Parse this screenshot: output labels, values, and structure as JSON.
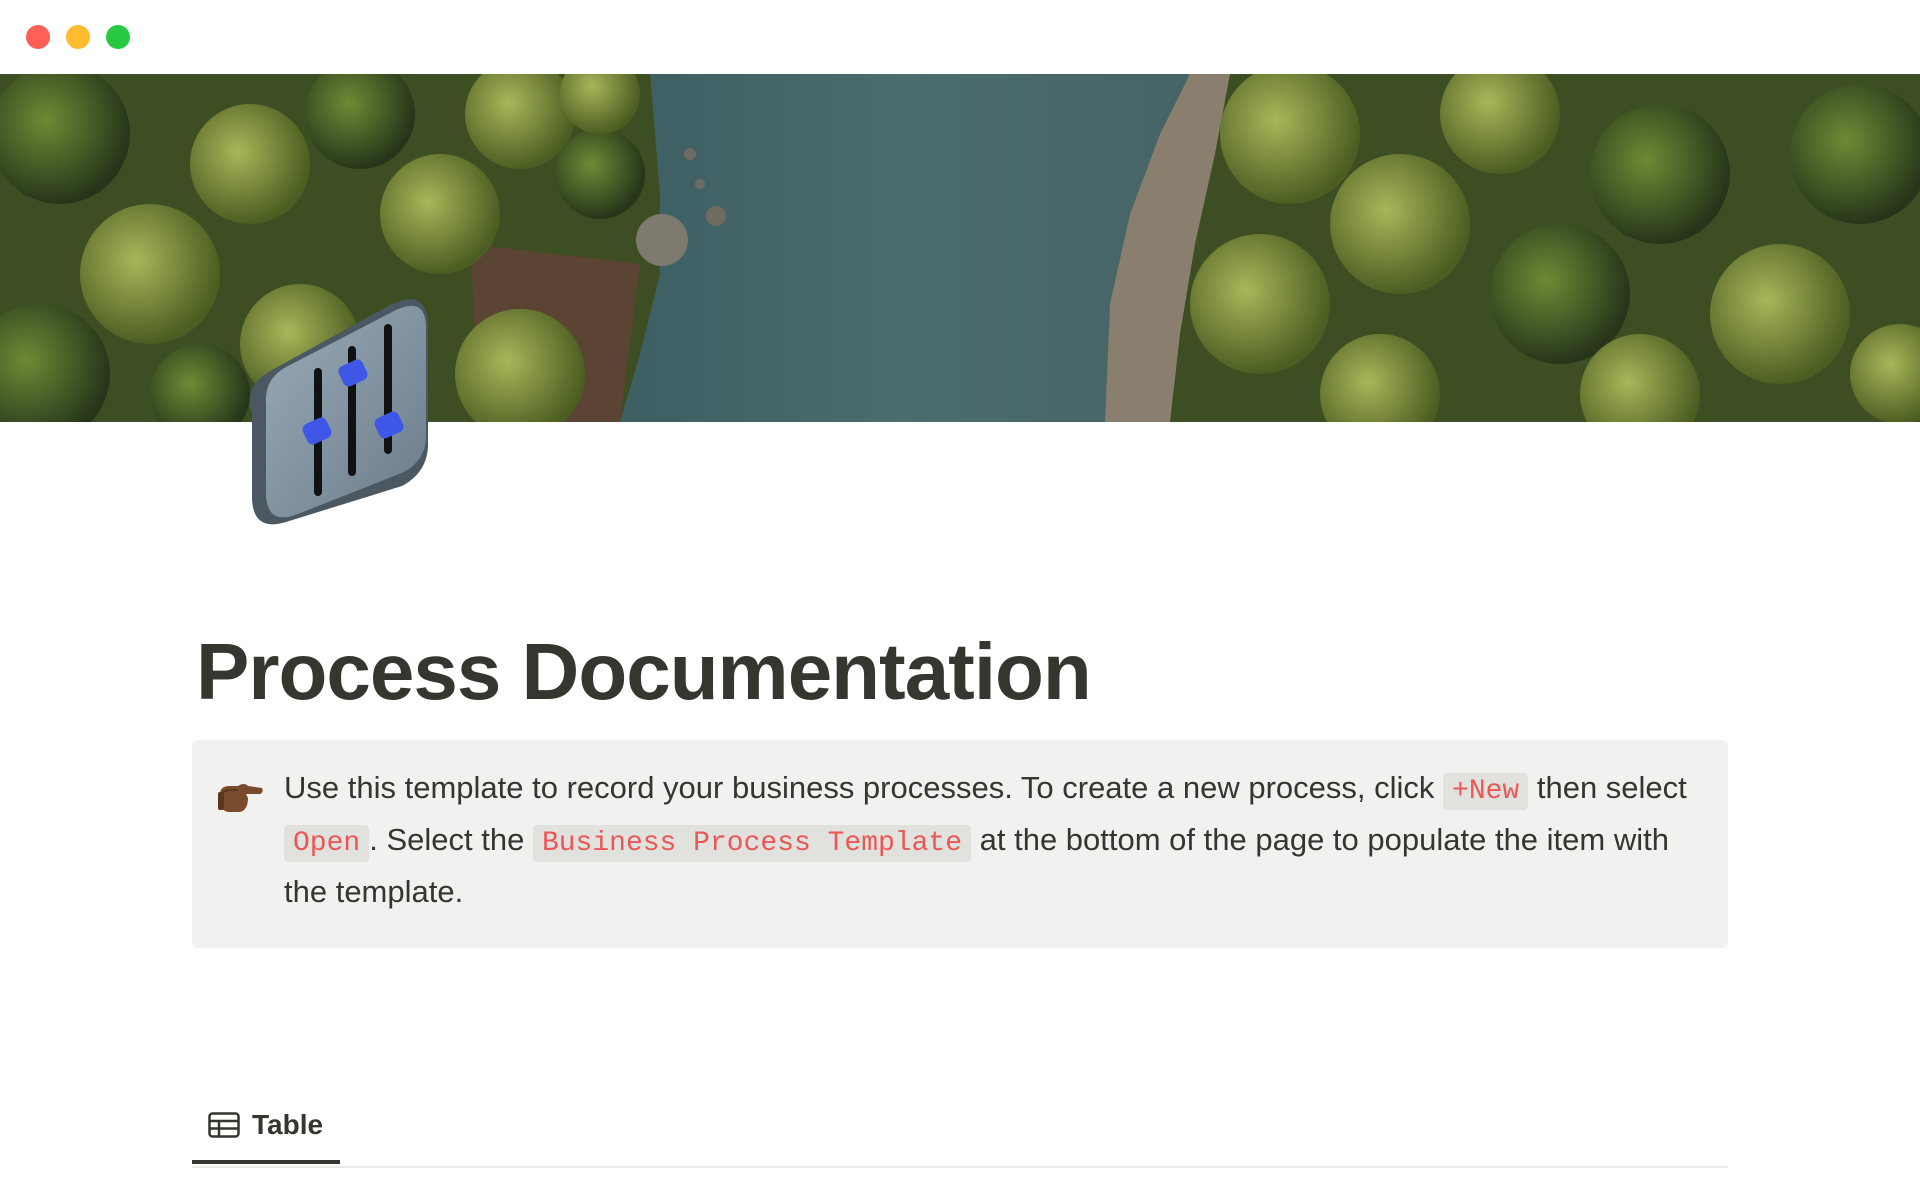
{
  "window": {
    "controls": [
      "close-button",
      "minimize-button",
      "zoom-button"
    ],
    "colors": {
      "close": "#fe5f57",
      "minimize": "#febc2e",
      "zoom": "#28c840"
    }
  },
  "page": {
    "title": "Process Documentation",
    "icon": "sliders-icon",
    "cover": "aerial-forest-river-image"
  },
  "callout": {
    "icon": "pointing-hand-icon",
    "text_1": "Use this template to record your business processes. To create a new process, click ",
    "code_1": "+New",
    "text_2": " then select ",
    "code_2": "Open",
    "text_3": ". Select the ",
    "code_3": "Business Process Template",
    "text_4": " at the bottom of the page to populate the item with the template.",
    "background": "#f1f1ef",
    "code_color": "#eb5757"
  },
  "views": {
    "tabs": [
      {
        "label": "Table",
        "icon": "table-icon",
        "active": true
      }
    ]
  }
}
